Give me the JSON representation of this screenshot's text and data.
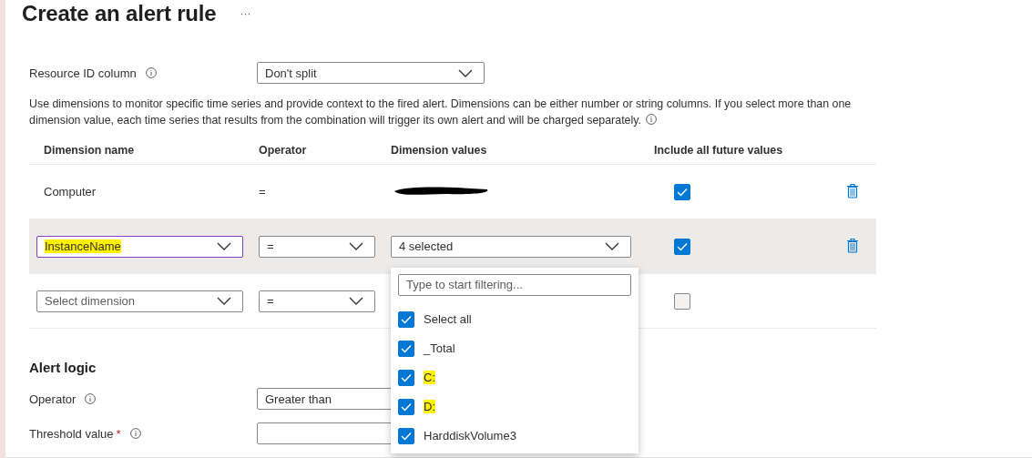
{
  "page": {
    "title": "Create an alert rule",
    "more": "···"
  },
  "resource_id": {
    "label": "Resource ID column",
    "value": "Don't split"
  },
  "description": "Use dimensions to monitor specific time series and provide context to the fired alert. Dimensions can be either number or string columns. If you select more than one dimension value, each time series that results from the combination will trigger its own alert and will be charged separately.",
  "dimensions": {
    "columns": [
      "Dimension name",
      "Operator",
      "Dimension values",
      "Include all future values"
    ],
    "rows": [
      {
        "kind": "static",
        "name": "Computer",
        "operator": "=",
        "values_redacted": true,
        "include_future": true,
        "selected": false
      },
      {
        "kind": "edit",
        "name": "InstanceName",
        "operator": "=",
        "values": "4 selected",
        "include_future": true,
        "selected": true,
        "highlighted": true
      },
      {
        "kind": "new",
        "placeholder": "Select dimension",
        "operator": "=",
        "include_future": false,
        "selected": false
      }
    ]
  },
  "values_dropdown": {
    "filter_placeholder": "Type to start filtering...",
    "options": [
      {
        "label": "Select all",
        "checked": true,
        "highlighted": false
      },
      {
        "label": "_Total",
        "checked": true,
        "highlighted": false
      },
      {
        "label": "C:",
        "checked": true,
        "highlighted": true
      },
      {
        "label": "D:",
        "checked": true,
        "highlighted": true
      },
      {
        "label": "HarddiskVolume3",
        "checked": true,
        "highlighted": false
      }
    ]
  },
  "alert_logic": {
    "heading": "Alert logic",
    "operator": {
      "label": "Operator",
      "value": "Greater than"
    },
    "threshold": {
      "label": "Threshold value",
      "required": "*"
    }
  }
}
